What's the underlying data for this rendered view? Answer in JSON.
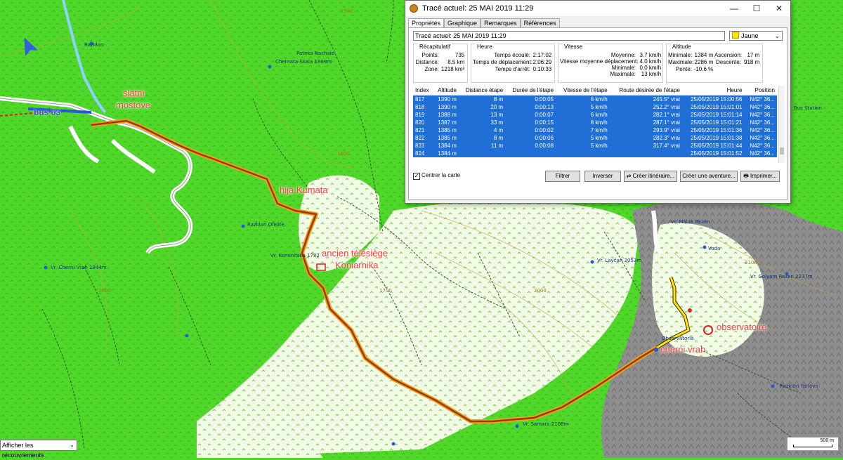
{
  "map": {
    "labels": {
      "slatni": "slatni",
      "mostove": "mostove",
      "bus": "bus 63",
      "hija": "hija Kumata",
      "ancien": "ancien télésiège",
      "koniarnika": "Koniarnika",
      "observatoire": "observatoire",
      "cherni": "cherni vrah"
    },
    "place_names": [
      "Pateka Nachalo",
      "Chernata Skala 1869m",
      "Razklon",
      "Vr. Cherni Vrah 1844m",
      "Vr. Kominitska 1782",
      "Razklon Ofelite",
      "Vr. Layčan 2053m",
      "Vr. Samara 2108m",
      "Vr. Malak Rezen",
      "Vr. Golyam Rezen 2277m",
      "Observatoria",
      "Razklon Yarlovo",
      "Voda",
      "Bus Station"
    ],
    "contours": [
      "1500",
      "1800",
      "2000",
      "2100",
      "1600",
      "1700"
    ],
    "overlay_select": "Afficher les recouvrements",
    "scale": "500 m",
    "colors": {
      "forest": "#4fd82a",
      "meadow": "#f2fbe6",
      "rock": "#9b9b9b",
      "track": "#9a3a06",
      "track_halo": "#f2a21a",
      "selected_segment": "#ffe40a"
    }
  },
  "dialog": {
    "title": "Tracé actuel: 25 MAI 2019 11:29",
    "tabs": [
      "Propriétés",
      "Graphique",
      "Remarques",
      "Références"
    ],
    "name_value": "Tracé actuel: 25 MAI 2019 11:29",
    "color_value": "Jaune",
    "summary": {
      "title": "Récapitulatif",
      "points_k": "Points:",
      "points_v": "735",
      "distance_k": "Distance:",
      "distance_v": "8.5 km",
      "zone_k": "Zone:",
      "zone_v": "1218 km²"
    },
    "time": {
      "title": "Heure",
      "elapsed_k": "Temps écoulé:",
      "elapsed_v": "2:17:02",
      "moving_k": "Temps de déplacement:",
      "moving_v": "2:06:29",
      "stopped_k": "Temps d'arrêt:",
      "stopped_v": "0:10:33"
    },
    "speed": {
      "title": "Vitesse",
      "avg_k": "Moyenne:",
      "avg_v": "3.7 km/h",
      "moving_avg_k": "Vitesse moyenne déplacement:",
      "moving_avg_v": "4.0 km/h",
      "min_k": "Minimale:",
      "min_v": "0.0 km/h",
      "max_k": "Maximale:",
      "max_v": "13 km/h"
    },
    "altitude": {
      "title": "Altitude",
      "min_k": "Minimale:",
      "min_v": "1384 m",
      "max_k": "Maximale:",
      "max_v": "2286 m",
      "slope_k": "Pente:",
      "slope_v": "-10.6 %",
      "ascent_k": "Ascension:",
      "ascent_v": "17 m",
      "descent_k": "Descente:",
      "descent_v": "918 m"
    },
    "columns": [
      "Index",
      "Altitude",
      "Distance étape",
      "Durée de l'étape",
      "Vitesse de l'étape",
      "Route désirée de l'étape",
      "Heure",
      "Position"
    ],
    "rows": [
      [
        "817",
        "1390 m",
        "8 m",
        "0:00:05",
        "6 km/h",
        "245.5° vrai",
        "25/05/2019 15:00:56",
        "N42° 36..."
      ],
      [
        "818",
        "1390 m",
        "20 m",
        "0:00:13",
        "5 km/h",
        "252.2° vrai",
        "25/05/2019 15:01:01",
        "N42° 36..."
      ],
      [
        "819",
        "1388 m",
        "13 m",
        "0:00:07",
        "6 km/h",
        "282.1° vrai",
        "25/05/2019 15:01:14",
        "N42° 36..."
      ],
      [
        "820",
        "1387 m",
        "33 m",
        "0:00:15",
        "8 km/h",
        "287.1° vrai",
        "25/05/2019 15:01:21",
        "N42° 36..."
      ],
      [
        "821",
        "1385 m",
        "4 m",
        "0:00:02",
        "7 km/h",
        "293.9° vrai",
        "25/05/2019 15:01:36",
        "N42° 36..."
      ],
      [
        "822",
        "1385 m",
        "8 m",
        "0:00:06",
        "5 km/h",
        "282.3° vrai",
        "25/05/2019 15:01:38",
        "N42° 36..."
      ],
      [
        "823",
        "1384 m",
        "11 m",
        "0:00:08",
        "5 km/h",
        "317.4° vrai",
        "25/05/2019 15:01:44",
        "N42° 36..."
      ],
      [
        "824",
        "1384 m",
        "",
        "",
        "",
        "",
        "25/05/2019 15:01:52",
        "N42° 36..."
      ]
    ],
    "center_map": "Centrer la carte",
    "buttons": {
      "filter": "Filtrer",
      "invert": "Inverser",
      "create_route": "Créer itinéraire...",
      "create_adventure": "Créer une aventure...",
      "print": "Imprimer..."
    }
  }
}
